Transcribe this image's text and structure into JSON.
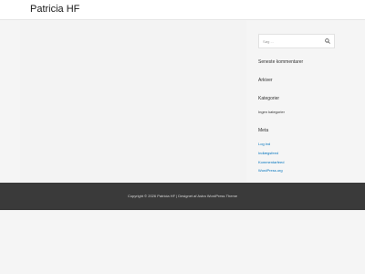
{
  "header": {
    "site_title": "Patricia HF"
  },
  "sidebar": {
    "search": {
      "placeholder": "Søg ...",
      "icon": "search-icon"
    },
    "recent_comments": {
      "title": "Seneste kommentarer"
    },
    "archives": {
      "title": "Arkiver"
    },
    "categories": {
      "title": "Kategorier",
      "empty_text": "Ingen kategorier"
    },
    "meta": {
      "title": "Meta",
      "links": [
        "Log ind",
        "Indlægsfeed",
        "Kommentarfeed",
        "WordPress.org"
      ]
    }
  },
  "footer": {
    "text": "Copyright © 2026 Patricia HF | Designet af Astra WordPress Theme"
  },
  "colors": {
    "background": "#f5f5f5",
    "header_bg": "#ffffff",
    "footer_bg": "#3a3a3a",
    "link": "#0274be"
  }
}
